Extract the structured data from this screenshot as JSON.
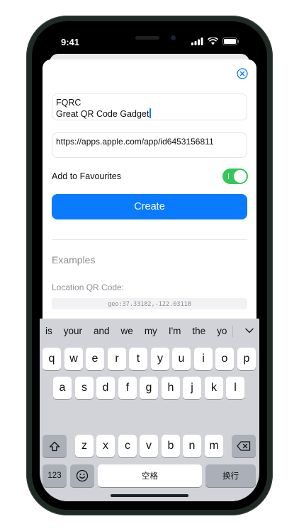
{
  "status": {
    "time": "9:41"
  },
  "form": {
    "name_line1": "FQRC",
    "name_line2": "Great QR Code Gadget",
    "url": "https://apps.apple.com/app/id6453156811",
    "favourite_label": "Add to Favourites",
    "favourite_on": true,
    "create_label": "Create"
  },
  "examples": {
    "title": "Examples",
    "location_label": "Location QR Code:",
    "location_code": "geo:37.33182,-122.03118"
  },
  "keyboard": {
    "suggestions": [
      "is",
      "your",
      "and",
      "we",
      "my",
      "I'm",
      "the",
      "yo"
    ],
    "row1": [
      "q",
      "w",
      "e",
      "r",
      "t",
      "y",
      "u",
      "i",
      "o",
      "p"
    ],
    "row2": [
      "a",
      "s",
      "d",
      "f",
      "g",
      "h",
      "j",
      "k",
      "l"
    ],
    "row3": [
      "z",
      "x",
      "c",
      "v",
      "b",
      "n",
      "m"
    ],
    "numbers_label": "123",
    "space_label": "空格",
    "return_label": "换行"
  },
  "colors": {
    "accent": "#0a7aff",
    "toggle_on": "#34c759"
  },
  "icons": [
    "close-circle-icon",
    "signal-icon",
    "wifi-icon",
    "battery-icon",
    "chevron-down-icon",
    "shift-icon",
    "delete-icon",
    "emoji-icon",
    "globe-icon",
    "microphone-icon"
  ]
}
